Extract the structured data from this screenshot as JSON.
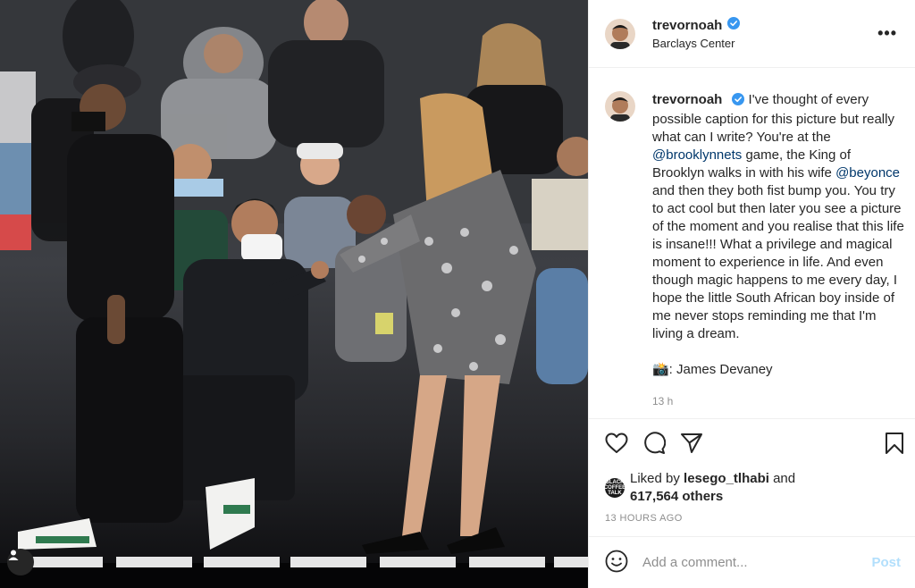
{
  "post": {
    "username": "trevornoah",
    "location": "Barclays Center",
    "verified": true,
    "more_label": "•••"
  },
  "caption": {
    "username": "trevornoah",
    "part1": "I've thought of every possible caption for this picture but really what can I write? You're at the ",
    "mention1": "@brooklynnets",
    "part2": " game, the King of Brooklyn walks in with his wife ",
    "mention2": "@beyonce",
    "part3": " and then they both fist bump you. You try to act cool but then later you see a picture of the moment and you realise that this life is insane!!! What a privilege and magical moment to experience in life. And even though magic happens to me every day, I hope the little South African boy inside of me never stops reminding me that I'm living a dream.",
    "credit": "📸: James Devaney",
    "relative_time": "13 h"
  },
  "likes": {
    "prefix": "Liked by ",
    "liker": "lesego_tlhabi",
    "middle": " and",
    "others": "617,564 others",
    "liker_avatar_text": "BLACK COFFEE TALK"
  },
  "timestamp": "13 HOURS AGO",
  "comment_box": {
    "placeholder": "Add a comment...",
    "post_label": "Post"
  },
  "icons": {
    "like": "heart-icon",
    "comment": "comment-bubble-icon",
    "share": "paper-plane-icon",
    "save": "bookmark-icon",
    "emoji": "smiley-icon",
    "user_tag": "person-icon",
    "verified": "verified-badge-icon"
  },
  "colors": {
    "link": "#00376b",
    "verified": "#3897f0",
    "post_disabled": "#b2dffc",
    "muted": "#8e8e8e"
  }
}
